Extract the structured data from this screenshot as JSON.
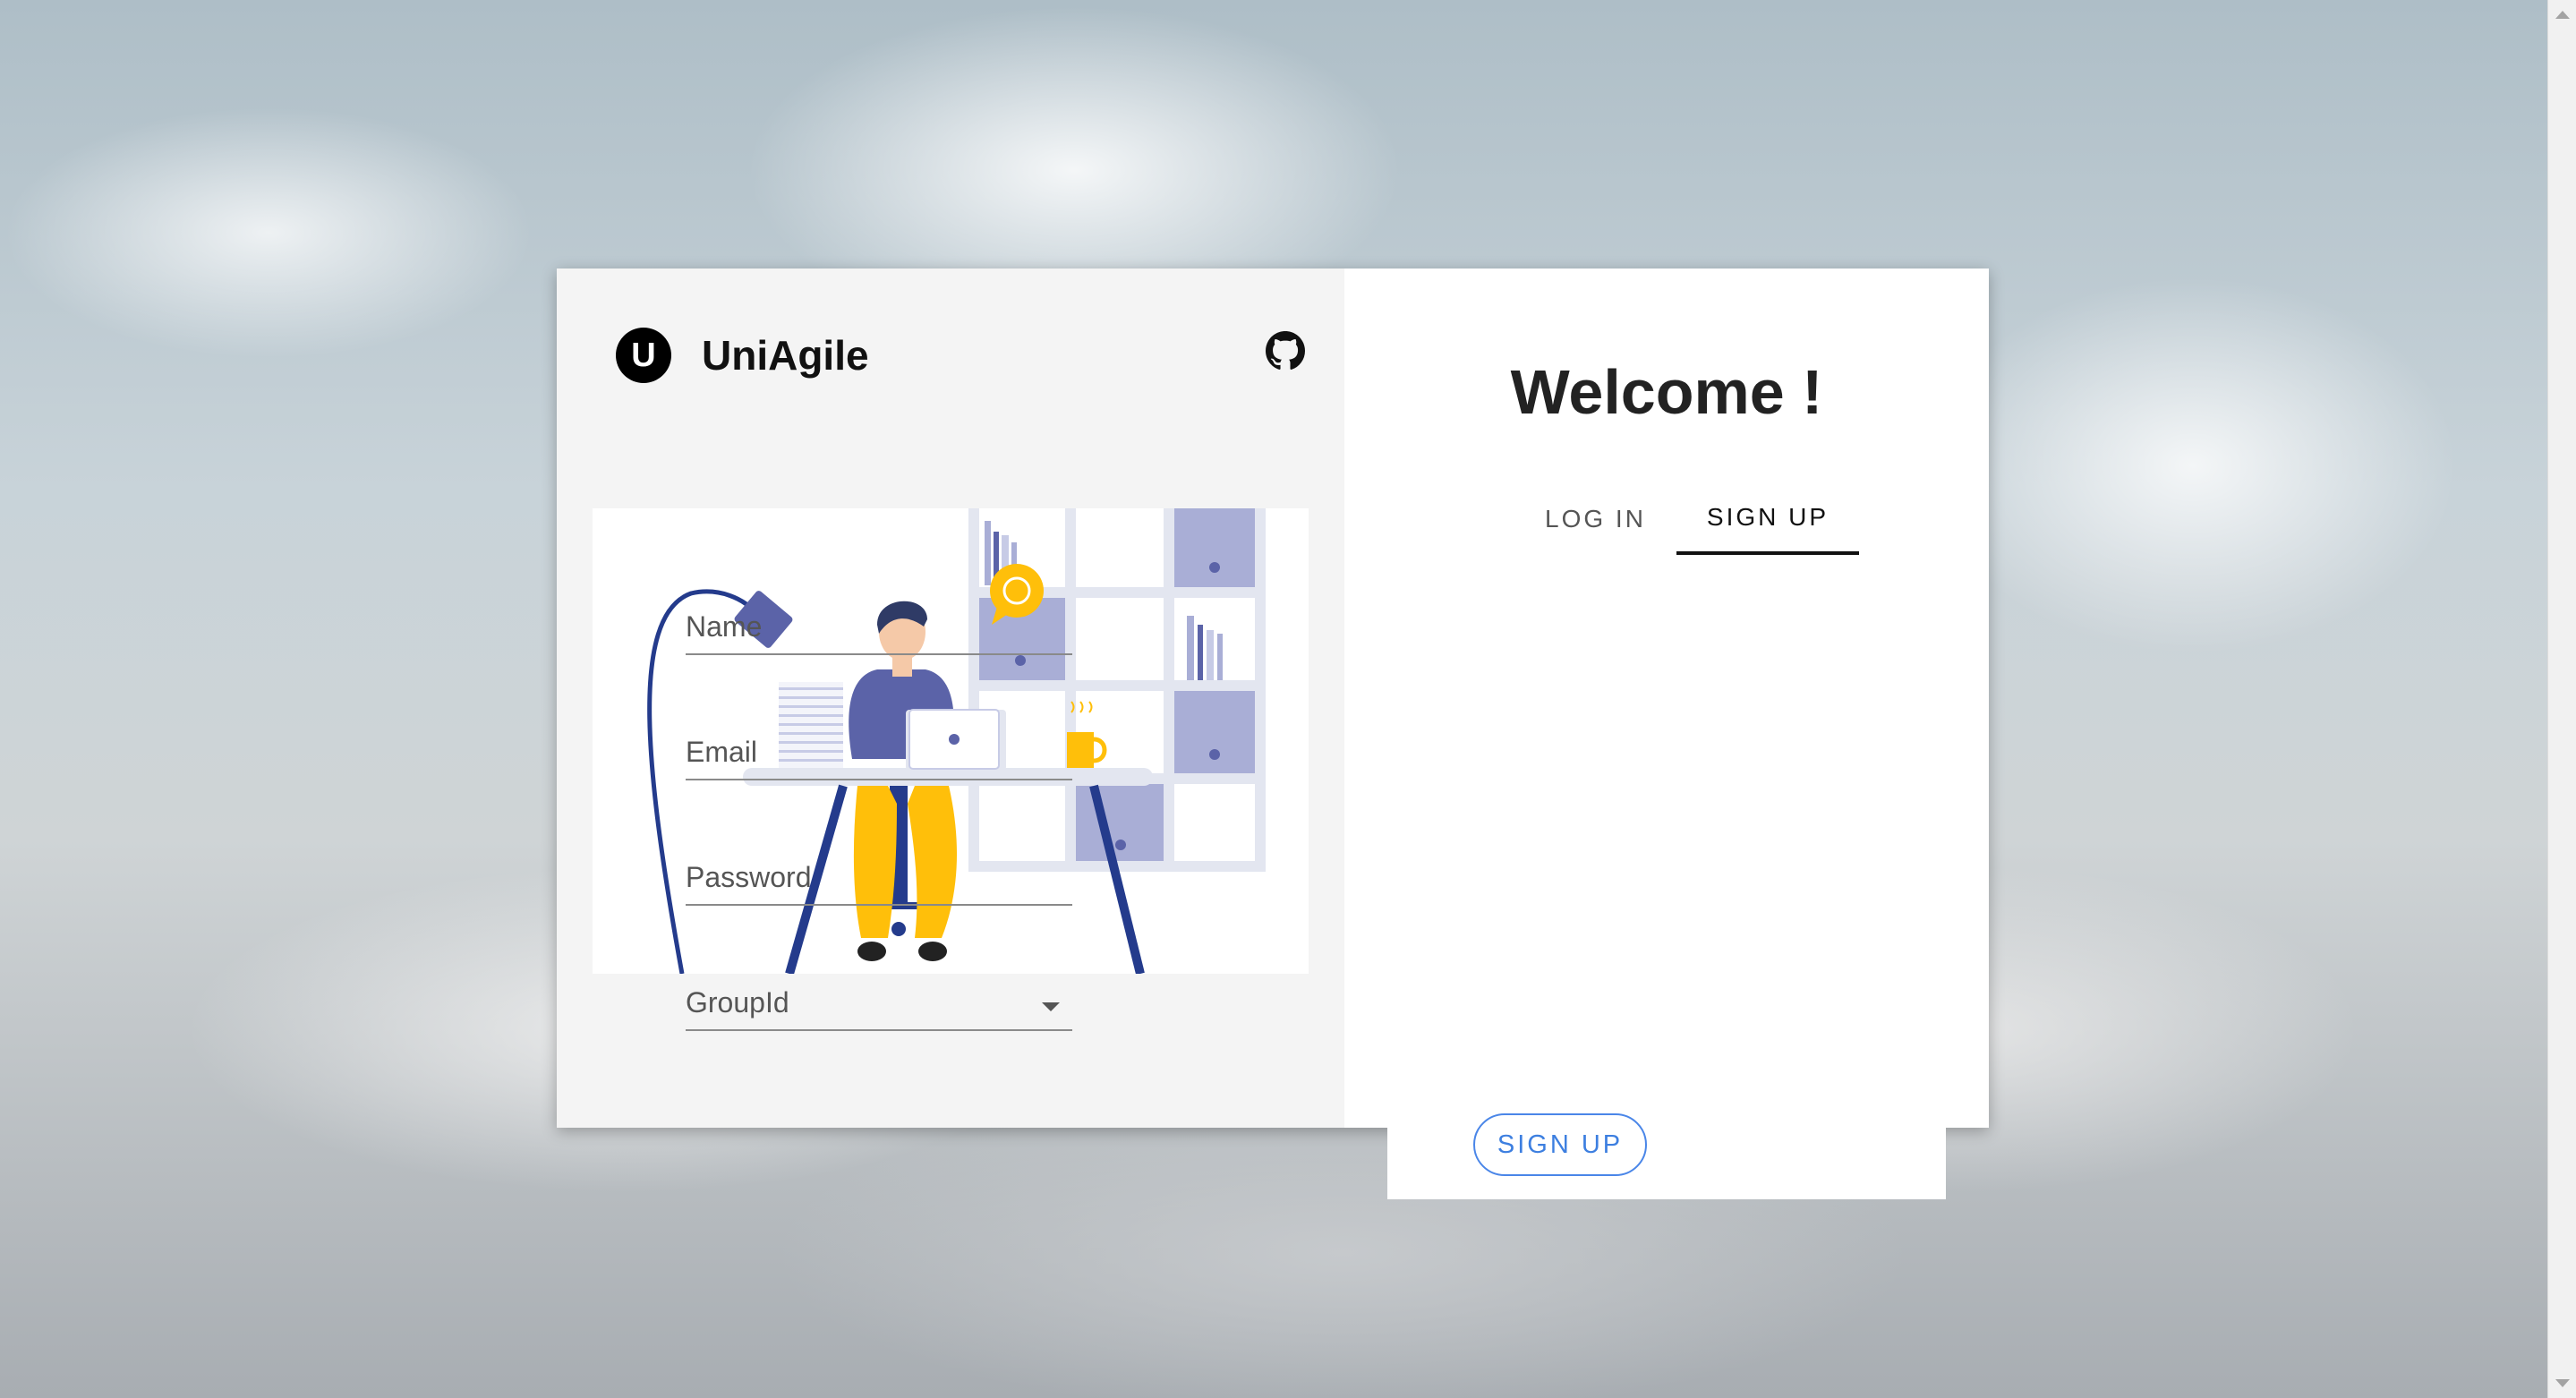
{
  "brand": {
    "logo_letter": "U",
    "name": "UniAgile"
  },
  "header": {
    "github_icon": "github-icon"
  },
  "auth": {
    "title": "Welcome !",
    "tabs": [
      {
        "label": "LOG IN",
        "active": false
      },
      {
        "label": "SIGN UP",
        "active": true
      }
    ],
    "fields": {
      "name": {
        "placeholder": "Name",
        "value": ""
      },
      "email": {
        "placeholder": "Email",
        "value": ""
      },
      "password": {
        "placeholder": "Password",
        "value": ""
      },
      "group": {
        "label": "GroupId",
        "value": ""
      }
    },
    "submit_label": "SIGN UP"
  },
  "colors": {
    "accent": "#3d7fe0",
    "illustration_primary": "#5b63a8",
    "illustration_accent": "#ffbf0a",
    "illustration_navy": "#243b8c"
  }
}
